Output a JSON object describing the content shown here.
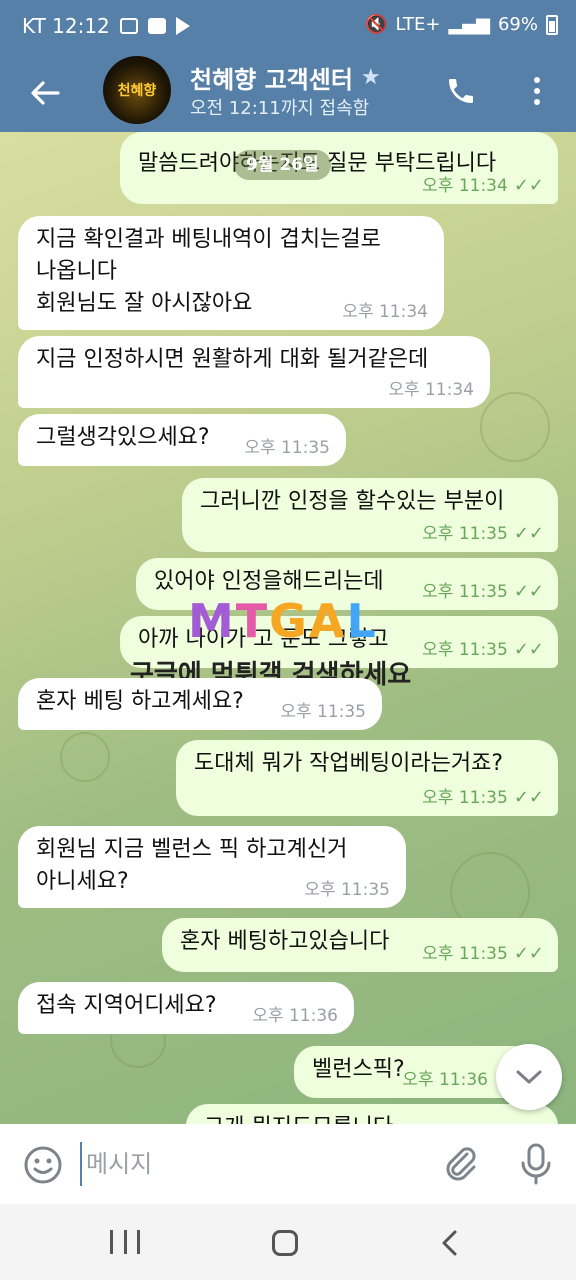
{
  "status_bar": {
    "carrier_time": "KT 12:12",
    "network": "LTE+",
    "battery": "69%"
  },
  "header": {
    "avatar_text": "천혜향",
    "title": "천혜향 고객센터",
    "subtitle": "오전 12:11까지 접속함"
  },
  "chat": {
    "date": "9월 26일",
    "messages": [
      {
        "dir": "out",
        "lines": [
          "말씀드려야하는지도 질문 부탁드립니다"
        ],
        "time": "오후 11:34",
        "read": "✓✓"
      },
      {
        "dir": "in",
        "lines": [
          "지금 확인결과 베팅내역이 겹치는걸로",
          "나옵니다",
          "회원님도 잘 아시잖아요"
        ],
        "time": "오후 11:34"
      },
      {
        "dir": "in",
        "lines": [
          "지금 인정하시면 원활하게 대화 될거같은데"
        ],
        "time": "오후 11:34"
      },
      {
        "dir": "in",
        "lines": [
          "그럴생각있으세요?"
        ],
        "time": "오후 11:35"
      },
      {
        "dir": "out",
        "lines": [
          "그러니깐 인정을 할수있는 부분이"
        ],
        "time": "오후 11:35",
        "read": "✓✓"
      },
      {
        "dir": "out",
        "lines": [
          "있어야 인정을해드리는데"
        ],
        "time": "오후 11:35",
        "read": "✓✓"
      },
      {
        "dir": "out",
        "lines": [
          "아까 나이가 고 문도 그렇고"
        ],
        "time": "오후 11:35",
        "read": "✓✓"
      },
      {
        "dir": "in",
        "lines": [
          "혼자 베팅 하고계세요?"
        ],
        "time": "오후 11:35"
      },
      {
        "dir": "out",
        "lines": [
          "도대체 뭐가 작업베팅이라는거죠?"
        ],
        "time": "오후 11:35",
        "read": "✓✓"
      },
      {
        "dir": "in",
        "lines": [
          "회원님 지금 벨런스 픽 하고계신거",
          "아니세요?"
        ],
        "time": "오후 11:35"
      },
      {
        "dir": "out",
        "lines": [
          "혼자 베팅하고있습니다"
        ],
        "time": "오후 11:35",
        "read": "✓✓"
      },
      {
        "dir": "in",
        "lines": [
          "접속 지역어디세요?"
        ],
        "time": "오후 11:36"
      },
      {
        "dir": "out",
        "lines": [
          "벨런스픽?"
        ],
        "time": "오후 11:36",
        "read": "✓✓"
      },
      {
        "dir": "out",
        "lines": [
          "그게 뭔지도모릅니다"
        ],
        "time": "",
        "read": ""
      }
    ]
  },
  "watermark": {
    "logo_parts": [
      "M",
      "T",
      "GA",
      "L"
    ],
    "caption": "구글에 먹튀갤 검색하세요"
  },
  "input": {
    "placeholder": "메시지"
  },
  "icons": {
    "back": "back-arrow-icon",
    "star": "star-icon",
    "call": "phone-icon",
    "menu": "more-vert-icon",
    "emoji": "emoji-icon",
    "attach": "paperclip-icon",
    "mic": "microphone-icon",
    "scroll": "chevron-down-icon"
  },
  "colors": {
    "header_bg": "#5780a8",
    "outgoing_bubble": "#effedd",
    "incoming_bubble": "#ffffff",
    "read_check": "#6aa55c"
  }
}
